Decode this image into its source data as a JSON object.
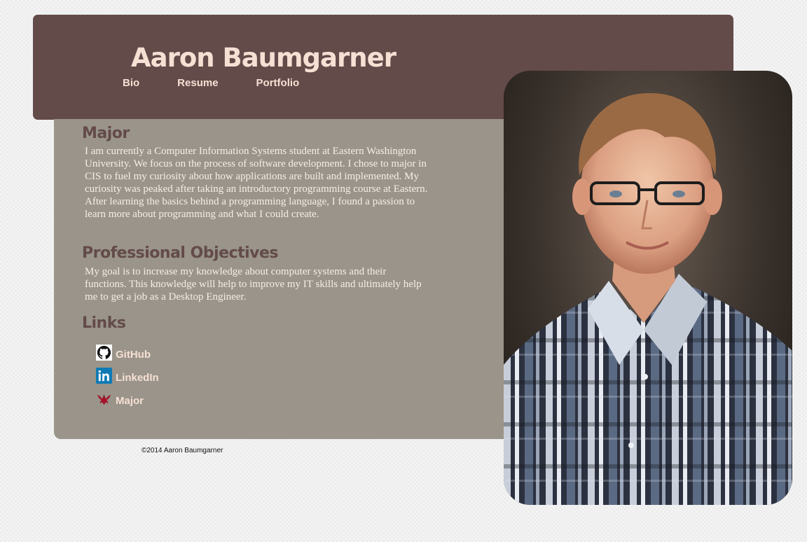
{
  "header": {
    "title": "Aaron Baumgarner",
    "nav": [
      "Bio",
      "Resume",
      "Portfolio"
    ]
  },
  "major": {
    "title": "Major",
    "text": "I am currently a Computer Information Systems student at Eastern Washington University. We focus on the process of software development. I chose to major in CIS to fuel my curiosity about how applications are built and implemented. My curiosity was peaked after taking an introductory programming course at Eastern. After learning the basics behind a programming language, I found a passion to learn more about programming and what I could create."
  },
  "objectives": {
    "title": "Professional Objectives",
    "text": "My goal is to increase my knowledge about computer systems and their functions. This knowledge will help to improve my IT skills and ultimately help me to get a job as a Desktop Engineer."
  },
  "links": {
    "title": "Links",
    "items": [
      {
        "label": "GitHub",
        "icon": "github-icon"
      },
      {
        "label": "LinkedIn",
        "icon": "linkedin-icon"
      },
      {
        "label": "Major",
        "icon": "eagle-icon"
      }
    ]
  },
  "footer": {
    "copyright": "©2014 Aaron Baumgarner"
  },
  "colors": {
    "header_bg": "#634b4a",
    "content_bg": "#9a948a",
    "accent_text": "#f6e0d4"
  }
}
